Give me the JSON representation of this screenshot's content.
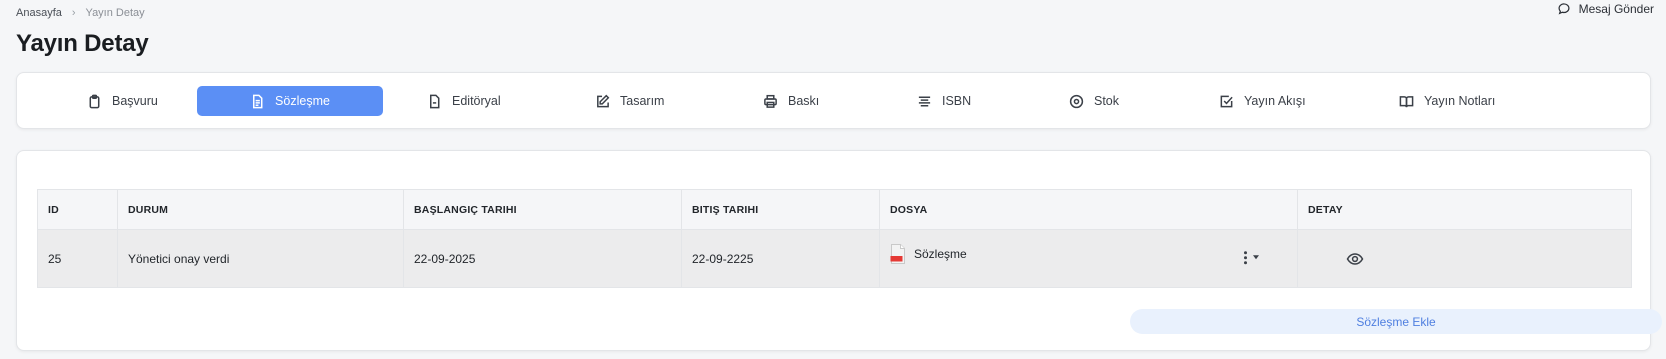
{
  "breadcrumb": {
    "home": "Anasayfa",
    "current": "Yayın Detay"
  },
  "header": {
    "send_message": "Mesaj Gönder"
  },
  "page": {
    "title": "Yayın Detay"
  },
  "tabs": [
    {
      "label": "Başvuru",
      "icon": "clipboard-icon",
      "active": false
    },
    {
      "label": "Sözleşme",
      "icon": "document-icon",
      "active": true
    },
    {
      "label": "Editöryal",
      "icon": "file-minus-icon",
      "active": false
    },
    {
      "label": "Tasarım",
      "icon": "edit-icon",
      "active": false
    },
    {
      "label": "Baskı",
      "icon": "printer-icon",
      "active": false
    },
    {
      "label": "ISBN",
      "icon": "lines-icon",
      "active": false
    },
    {
      "label": "Stok",
      "icon": "disc-icon",
      "active": false
    },
    {
      "label": "Yayın Akışı",
      "icon": "checkbox-icon",
      "active": false
    },
    {
      "label": "Yayın Notları",
      "icon": "book-icon",
      "active": false
    }
  ],
  "table": {
    "columns": [
      "ID",
      "DURUM",
      "BAŞLANGIÇ TARIHI",
      "BITIŞ TARIHI",
      "DOSYA",
      "DETAY"
    ],
    "rows": [
      {
        "id": "25",
        "status": "Yönetici onay verdi",
        "start": "22-09-2025",
        "end": "22-09-2225",
        "file": "Sözleşme"
      }
    ]
  },
  "actions": {
    "add_contract": "Sözleşme Ekle"
  },
  "colors": {
    "accent": "#5b8ff5",
    "add_button_bg": "#e9f1fd",
    "add_button_text": "#4f7fe0",
    "pdf_red": "#e53935"
  }
}
